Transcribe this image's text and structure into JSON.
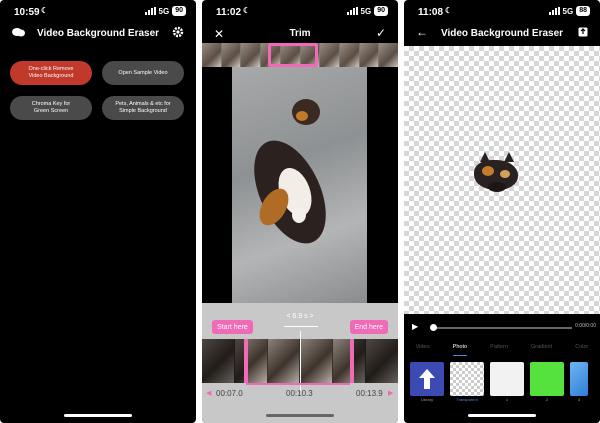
{
  "screen1": {
    "status": {
      "time": "10:59",
      "network": "5G",
      "battery": "90"
    },
    "title": "Video Background Eraser",
    "left_icon": "chat-bubbles-icon",
    "right_icon": "gear-icon",
    "buttons": [
      {
        "label": "One-click Remove Video Background",
        "color": "#c0392b"
      },
      {
        "label": "Open Sample Video",
        "color": "#4a4a4a"
      },
      {
        "label": "Chroma Key for Green Screen",
        "color": "#4a4a4a"
      },
      {
        "label": "Pets, Animals & etc for Simple Background",
        "color": "#4a4a4a"
      }
    ]
  },
  "screen2": {
    "status": {
      "time": "11:02",
      "network": "5G",
      "battery": "90"
    },
    "title": "Trim",
    "close_icon": "close-icon",
    "confirm_icon": "checkmark-icon",
    "start_label": "Start here",
    "end_label": "End here",
    "duration": "< 6.9 s >",
    "times": [
      "00:07.0",
      "00:10.3",
      "00:13.9"
    ],
    "accent": "#f06ab6"
  },
  "screen3": {
    "status": {
      "time": "11:08",
      "network": "5G",
      "battery": "88"
    },
    "title": "Video Background Eraser",
    "back_icon": "back-arrow-icon",
    "export_icon": "export-icon",
    "time_readout": "0:00/0:00",
    "tabs": [
      "Video",
      "Photo",
      "Pattern",
      "Gradient",
      "Color"
    ],
    "active_tab": "Photo",
    "tiles": [
      {
        "label": "Library",
        "color": "#3b4bb3"
      },
      {
        "label": "Transparent",
        "color": "checker"
      },
      {
        "label": "1",
        "color": "#f2f2f2"
      },
      {
        "label": "2",
        "color": "#55e23c"
      },
      {
        "label": "3",
        "color": "#2f7fd8"
      }
    ]
  }
}
